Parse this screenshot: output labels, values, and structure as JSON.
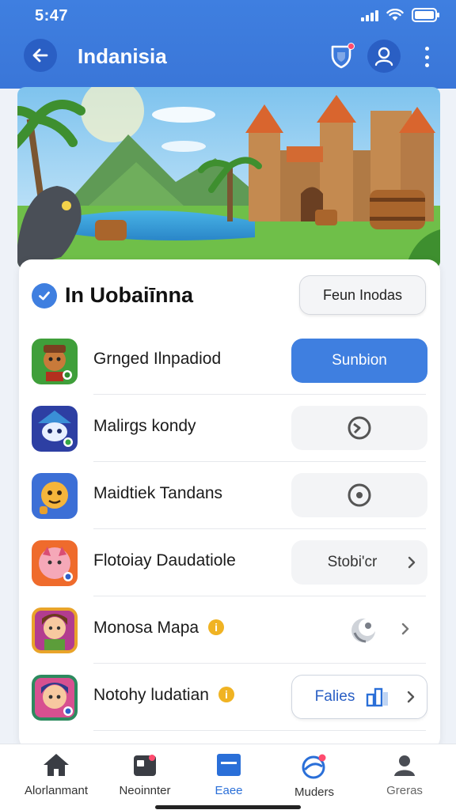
{
  "status": {
    "time": "5:47"
  },
  "header": {
    "title": "Indanisia"
  },
  "section": {
    "title": "In Uobaiīnna",
    "header_button": "Feun Inodas"
  },
  "apps": [
    {
      "name": "Grnged Ilnpadiod",
      "action": "Sunbion",
      "style": "primary",
      "info": ""
    },
    {
      "name": "Malirgs kondy",
      "action": "",
      "style": "icon",
      "info": ""
    },
    {
      "name": "Maidtiek Tandans",
      "action": "",
      "style": "icon",
      "info": ""
    },
    {
      "name": "Flotoiay Daudatiole",
      "action": "Stobi'cr",
      "style": "soft",
      "info": ""
    },
    {
      "name": "Monosa Mapa",
      "action": "",
      "style": "plain",
      "info": "i"
    },
    {
      "name": "Notohy ludatian",
      "action": "Falies",
      "style": "outline",
      "info": "i"
    }
  ],
  "nav": [
    {
      "label": "Alorlanmant",
      "icon": "home-icon"
    },
    {
      "label": "Neoinnter",
      "icon": "folder-icon"
    },
    {
      "label": "Eaee",
      "icon": "inbox-icon",
      "active": true
    },
    {
      "label": "Muders",
      "icon": "globe-icon"
    },
    {
      "label": "Greras",
      "icon": "user-icon"
    }
  ],
  "colors": {
    "primary": "#3f7fe0",
    "header": "#3a76d8",
    "badge": "#f0b323",
    "alert": "#ff4b6e"
  }
}
